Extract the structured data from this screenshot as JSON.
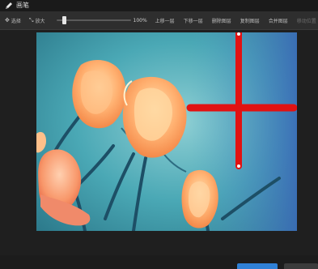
{
  "window": {
    "title": "画笔",
    "title_icon": "pen-icon"
  },
  "toolbar": {
    "select_label": "选择",
    "select_icon": "move-arrows-icon",
    "zoom_label": "放大",
    "zoom_icon": "expand-arrows-icon",
    "zoom_level": 0.08,
    "zoom_value": "100%",
    "move_up_label": "上移一层",
    "move_down_label": "下移一层",
    "delete_layer_label": "删除图层",
    "copy_layer_label": "复制图层",
    "merge_layer_label": "合并图层",
    "extra_label": "移动位置"
  },
  "canvas": {
    "image_subject": "orange-poppy-flowers-photo",
    "overlay_stroke_color": "#e11212",
    "overlay_shape": "red-cross-brush-strokes"
  },
  "colors": {
    "accent": "#2f80d6",
    "background": "#202020",
    "toolbar": "#2e2e2e"
  }
}
